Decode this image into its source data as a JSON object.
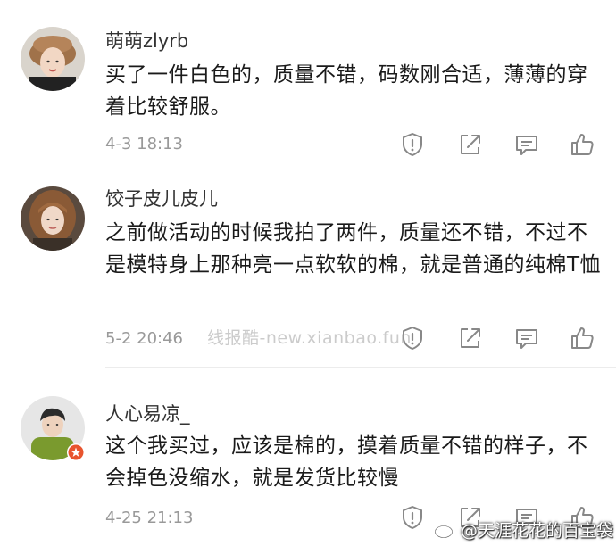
{
  "comments": [
    {
      "username": "萌萌zlyrb",
      "content": "买了一件白色的，质量不错，码数刚合适，薄薄的穿着比较舒服。",
      "time": "4-3 18:13",
      "avatar_icon": "user-avatar-photo"
    },
    {
      "username": "饺子皮儿皮儿",
      "content": "之前做活动的时候我拍了两件，质量还不错，不过不是模特身上那种亮一点软软的棉，就是普通的纯棉T恤",
      "time": "5-2 20:46",
      "avatar_icon": "user-avatar-photo"
    },
    {
      "username": "人心易凉_",
      "content": "这个我买过，应该是棉的，摸着质量不错的样子，不会掉色没缩水，就是发货比较慢",
      "time": "4-25 21:13",
      "avatar_icon": "user-avatar-photo",
      "badge_icon": "verified-badge-icon"
    }
  ],
  "actions": {
    "icons": [
      "report-icon",
      "share-icon",
      "comment-icon",
      "like-icon"
    ]
  },
  "watermarks": {
    "middle": "线报酷-new.xianbao.fun",
    "corner": "@天涯花花的百宝袋"
  },
  "colors": {
    "text": "#1a1a1a",
    "username": "#333333",
    "meta": "#999999",
    "icon": "#888888",
    "divider": "#ececec",
    "badge": "#e8542e"
  }
}
